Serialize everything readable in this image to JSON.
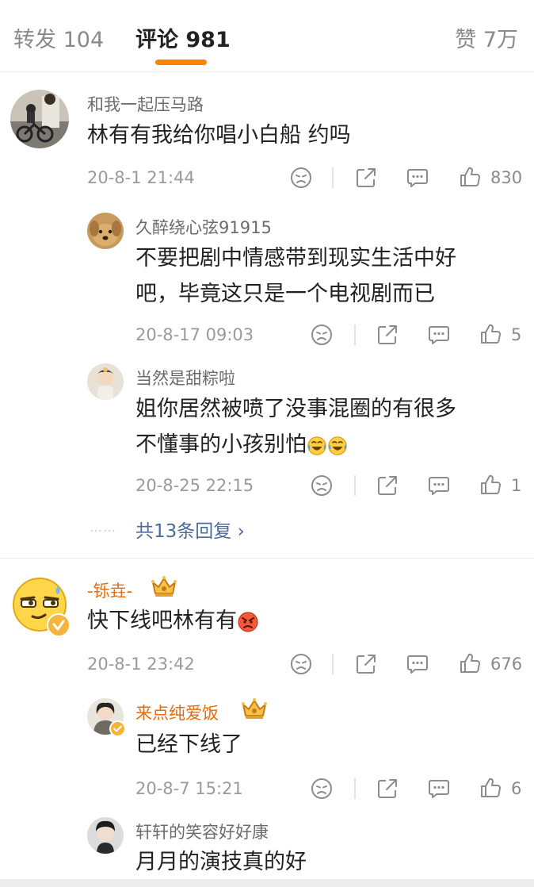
{
  "tabs": {
    "repost": "转发 104",
    "comment": "评论 981",
    "like": "赞 7万"
  },
  "colors": {
    "accent": "#ff8200",
    "link": "#4b6b9c",
    "vip_name": "#e56b0d"
  },
  "comments": [
    {
      "user": "和我一起压马路",
      "text": "林有有我给你唱小白船 约吗",
      "time": "20-8-1 21:44",
      "likes": "830",
      "replies": [
        {
          "user": "久醉绕心弦91915",
          "line1": "不要把剧中情感带到现实生活中好",
          "line2": "吧，毕竟这只是一个电视剧而已",
          "time": "20-8-17 09:03",
          "likes": "5"
        },
        {
          "user": "当然是甜粽啦",
          "line1": "姐你居然被喷了没事混圈的有很多",
          "line2": "不懂事的小孩别怕",
          "time": "20-8-25 22:15",
          "likes": "1"
        }
      ],
      "more_replies": "共13条回复",
      "dots": "……"
    },
    {
      "user": "-铄垚-",
      "text": "快下线吧林有有",
      "time": "20-8-1 23:42",
      "likes": "676",
      "replies": [
        {
          "user": "来点纯爱饭",
          "line1": "已经下线了",
          "time": "20-8-7 15:21",
          "likes": "6"
        },
        {
          "user": "轩轩的笑容好好康",
          "line1": "月月的演技真的好"
        }
      ]
    }
  ],
  "icons": [
    "emoji-face-icon",
    "share-icon",
    "comment-icon",
    "thumbs-up-icon",
    "crown-badge-icon",
    "laugh-cry-emoji",
    "angry-emoji",
    "verified-badge-icon"
  ]
}
